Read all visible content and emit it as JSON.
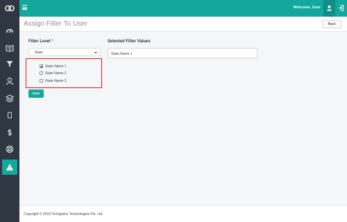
{
  "topbar": {
    "welcome_text": "Welcome, User"
  },
  "page": {
    "title": "Assign Filter To User",
    "back_label": "Back"
  },
  "form": {
    "filter_level_label": "Filter Level",
    "required_mark": "*",
    "filter_level_value": "State",
    "options": [
      {
        "label": "State Name 1",
        "checked": true
      },
      {
        "label": "State Name 2",
        "checked": false
      },
      {
        "label": "State Name 3",
        "checked": false
      }
    ],
    "save_label": "Save",
    "selected_values_label": "Selected Filter Values",
    "selected_values_text": "State Name 1"
  },
  "sidebar": {
    "items": [
      "dashboard-icon",
      "book-icon",
      "filter-icon",
      "user-icon",
      "layers-icon",
      "mobile-icon",
      "dollar-icon",
      "support-icon",
      "warning-icon"
    ]
  },
  "footer": {
    "copyright": "Copyright © 2018 Techgrains Technologies Pvt. Ltd."
  },
  "colors": {
    "accent": "#13a89e",
    "sidebar": "#2f3742",
    "highlight_border": "#d9161e"
  }
}
